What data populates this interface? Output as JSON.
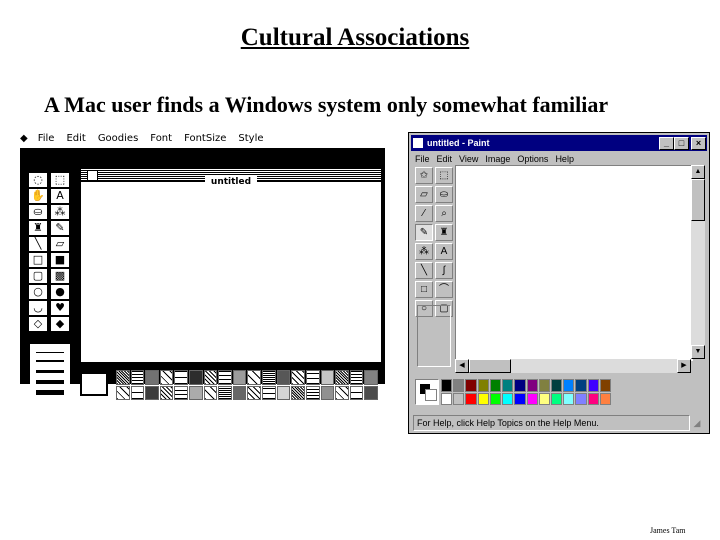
{
  "slide": {
    "title": "Cultural Associations",
    "subtitle": "A Mac user finds a Windows system only somewhat familiar",
    "credit": "James Tam"
  },
  "mac_paint": {
    "apple_menu_icon": "apple-icon",
    "menus": [
      "File",
      "Edit",
      "Goodies",
      "Font",
      "FontSize",
      "Style"
    ],
    "window_title": "untitled",
    "tools": [
      {
        "name": "lasso-icon",
        "glyph": "◌"
      },
      {
        "name": "marquee-icon",
        "glyph": "⬚"
      },
      {
        "name": "grabber-hand-icon",
        "glyph": "✋"
      },
      {
        "name": "text-icon",
        "glyph": "A"
      },
      {
        "name": "paint-bucket-icon",
        "glyph": "⛀"
      },
      {
        "name": "spray-can-icon",
        "glyph": "⁂"
      },
      {
        "name": "brush-icon",
        "glyph": "♜"
      },
      {
        "name": "pencil-icon",
        "glyph": "✎"
      },
      {
        "name": "line-icon",
        "glyph": "╲"
      },
      {
        "name": "eraser-icon",
        "glyph": "▱"
      },
      {
        "name": "rectangle-icon",
        "glyph": "□"
      },
      {
        "name": "filled-rectangle-icon",
        "glyph": "■"
      },
      {
        "name": "rounded-rect-icon",
        "glyph": "▢"
      },
      {
        "name": "filled-rounded-rect-icon",
        "glyph": "▩"
      },
      {
        "name": "oval-icon",
        "glyph": "○"
      },
      {
        "name": "filled-oval-icon",
        "glyph": "●"
      },
      {
        "name": "freeform-icon",
        "glyph": "◡"
      },
      {
        "name": "filled-freeform-icon",
        "glyph": "♥"
      },
      {
        "name": "polygon-icon",
        "glyph": "◇"
      },
      {
        "name": "filled-polygon-icon",
        "glyph": "◆"
      }
    ],
    "pattern_count": 36
  },
  "windows_paint": {
    "title": "untitled - Paint",
    "window_buttons": {
      "minimize": "_",
      "maximize": "□",
      "close": "×"
    },
    "menus": [
      "File",
      "Edit",
      "View",
      "Image",
      "Options",
      "Help"
    ],
    "tools": [
      {
        "name": "free-select-icon",
        "glyph": "✩"
      },
      {
        "name": "select-icon",
        "glyph": "⬚"
      },
      {
        "name": "eraser-icon",
        "glyph": "▱"
      },
      {
        "name": "fill-icon",
        "glyph": "⛀"
      },
      {
        "name": "pick-color-icon",
        "glyph": "⁄"
      },
      {
        "name": "magnifier-icon",
        "glyph": "⌕"
      },
      {
        "name": "pencil-icon",
        "glyph": "✎"
      },
      {
        "name": "brush-icon",
        "glyph": "♜"
      },
      {
        "name": "airbrush-icon",
        "glyph": "⁂"
      },
      {
        "name": "text-icon",
        "glyph": "A"
      },
      {
        "name": "line-icon",
        "glyph": "╲"
      },
      {
        "name": "curve-icon",
        "glyph": "∫"
      },
      {
        "name": "rectangle-icon",
        "glyph": "□"
      },
      {
        "name": "polygon-icon",
        "glyph": "⌒"
      },
      {
        "name": "ellipse-icon",
        "glyph": "○"
      },
      {
        "name": "rounded-rectangle-icon",
        "glyph": "▢"
      }
    ],
    "selected_tool": 6,
    "colors_top": [
      "#000000",
      "#808080",
      "#800000",
      "#808000",
      "#008000",
      "#008080",
      "#000080",
      "#800080",
      "#808040",
      "#004040",
      "#0080ff",
      "#004080",
      "#4000ff",
      "#804000"
    ],
    "colors_bottom": [
      "#ffffff",
      "#c0c0c0",
      "#ff0000",
      "#ffff00",
      "#00ff00",
      "#00ffff",
      "#0000ff",
      "#ff00ff",
      "#ffff80",
      "#00ff80",
      "#80ffff",
      "#8080ff",
      "#ff0080",
      "#ff8040"
    ],
    "status_text": "For Help, click Help Topics on the Help Menu."
  }
}
